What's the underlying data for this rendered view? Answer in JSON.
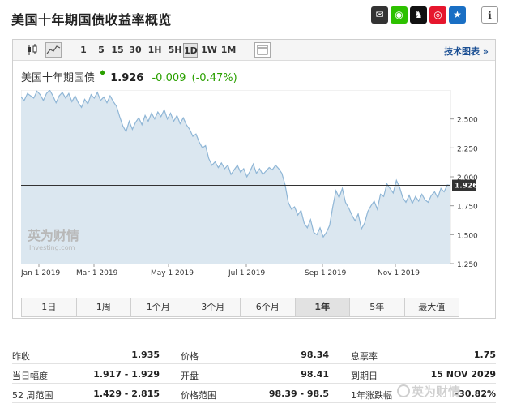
{
  "page": {
    "title": "美国十年期国债收益率概览"
  },
  "share_icons": [
    "mail-icon",
    "wechat-icon",
    "qq-icon",
    "weibo-icon",
    "favorite-icon",
    "info-icon"
  ],
  "toolbar": {
    "timeframes": [
      "1",
      "5",
      "15",
      "30",
      "1H",
      "5H",
      "1D",
      "1W",
      "1M"
    ],
    "active_timeframe": "1D",
    "tech_chart_link": "技术图表 »"
  },
  "quote": {
    "name": "美国十年期国债",
    "price": "1.926",
    "change": "-0.009",
    "change_pct": "(-0.47%)"
  },
  "watermark_logo": {
    "cn": "英为财情",
    "en": "Investing.com"
  },
  "ranges": [
    "1日",
    "1周",
    "1个月",
    "3个月",
    "6个月",
    "1年",
    "5年",
    "最大值"
  ],
  "active_range": "1年",
  "chart_data": {
    "type": "area",
    "x_ticks": [
      "Jan 1 2019",
      "Mar 1 2019",
      "May 1 2019",
      "Jul 1 2019",
      "Sep 1 2019",
      "Nov 1 2019"
    ],
    "y_ticks": [
      "2.500",
      "2.250",
      "2.000",
      "1.750",
      "1.500",
      "1.250"
    ],
    "ylim": [
      1.25,
      2.75
    ],
    "current_value": "1.926",
    "reference_line": 1.926,
    "series": [
      {
        "values": [
          2.69,
          2.66,
          2.72,
          2.7,
          2.68,
          2.74,
          2.71,
          2.66,
          2.72,
          2.75,
          2.7,
          2.64,
          2.7,
          2.73,
          2.68,
          2.72,
          2.65,
          2.7,
          2.64,
          2.6,
          2.67,
          2.63,
          2.71,
          2.68,
          2.73,
          2.66,
          2.69,
          2.64,
          2.7,
          2.65,
          2.61,
          2.52,
          2.44,
          2.39,
          2.48,
          2.41,
          2.47,
          2.51,
          2.45,
          2.53,
          2.48,
          2.55,
          2.5,
          2.56,
          2.52,
          2.58,
          2.5,
          2.55,
          2.48,
          2.53,
          2.46,
          2.51,
          2.45,
          2.41,
          2.35,
          2.37,
          2.3,
          2.25,
          2.27,
          2.16,
          2.1,
          2.13,
          2.08,
          2.12,
          2.07,
          2.1,
          2.02,
          2.06,
          2.1,
          2.04,
          2.07,
          2.0,
          2.05,
          2.11,
          2.03,
          2.07,
          2.02,
          2.05,
          2.08,
          2.06,
          2.1,
          2.07,
          2.03,
          1.93,
          1.78,
          1.72,
          1.74,
          1.67,
          1.71,
          1.6,
          1.56,
          1.63,
          1.52,
          1.5,
          1.56,
          1.48,
          1.52,
          1.58,
          1.74,
          1.88,
          1.82,
          1.9,
          1.78,
          1.73,
          1.67,
          1.62,
          1.68,
          1.55,
          1.6,
          1.7,
          1.75,
          1.79,
          1.72,
          1.85,
          1.83,
          1.94,
          1.9,
          1.86,
          1.97,
          1.91,
          1.82,
          1.78,
          1.84,
          1.77,
          1.83,
          1.79,
          1.85,
          1.8,
          1.78,
          1.84,
          1.87,
          1.82,
          1.9,
          1.87,
          1.93,
          1.926
        ]
      }
    ]
  },
  "stats": [
    [
      {
        "label": "昨收",
        "value": "1.935"
      },
      {
        "label": "价格",
        "value": "98.34"
      },
      {
        "label": "息票率",
        "value": "1.75"
      }
    ],
    [
      {
        "label": "当日幅度",
        "value": "1.917 - 1.929"
      },
      {
        "label": "开盘",
        "value": "98.41"
      },
      {
        "label": "到期日",
        "value": "15 NOV 2029"
      }
    ],
    [
      {
        "label": "52 周范围",
        "value": "1.429 - 2.815"
      },
      {
        "label": "价格范围",
        "value": "98.39 - 98.5"
      },
      {
        "label": "1年涨跌幅",
        "value": "-30.82%"
      }
    ]
  ],
  "corner_watermark": "英为财情"
}
